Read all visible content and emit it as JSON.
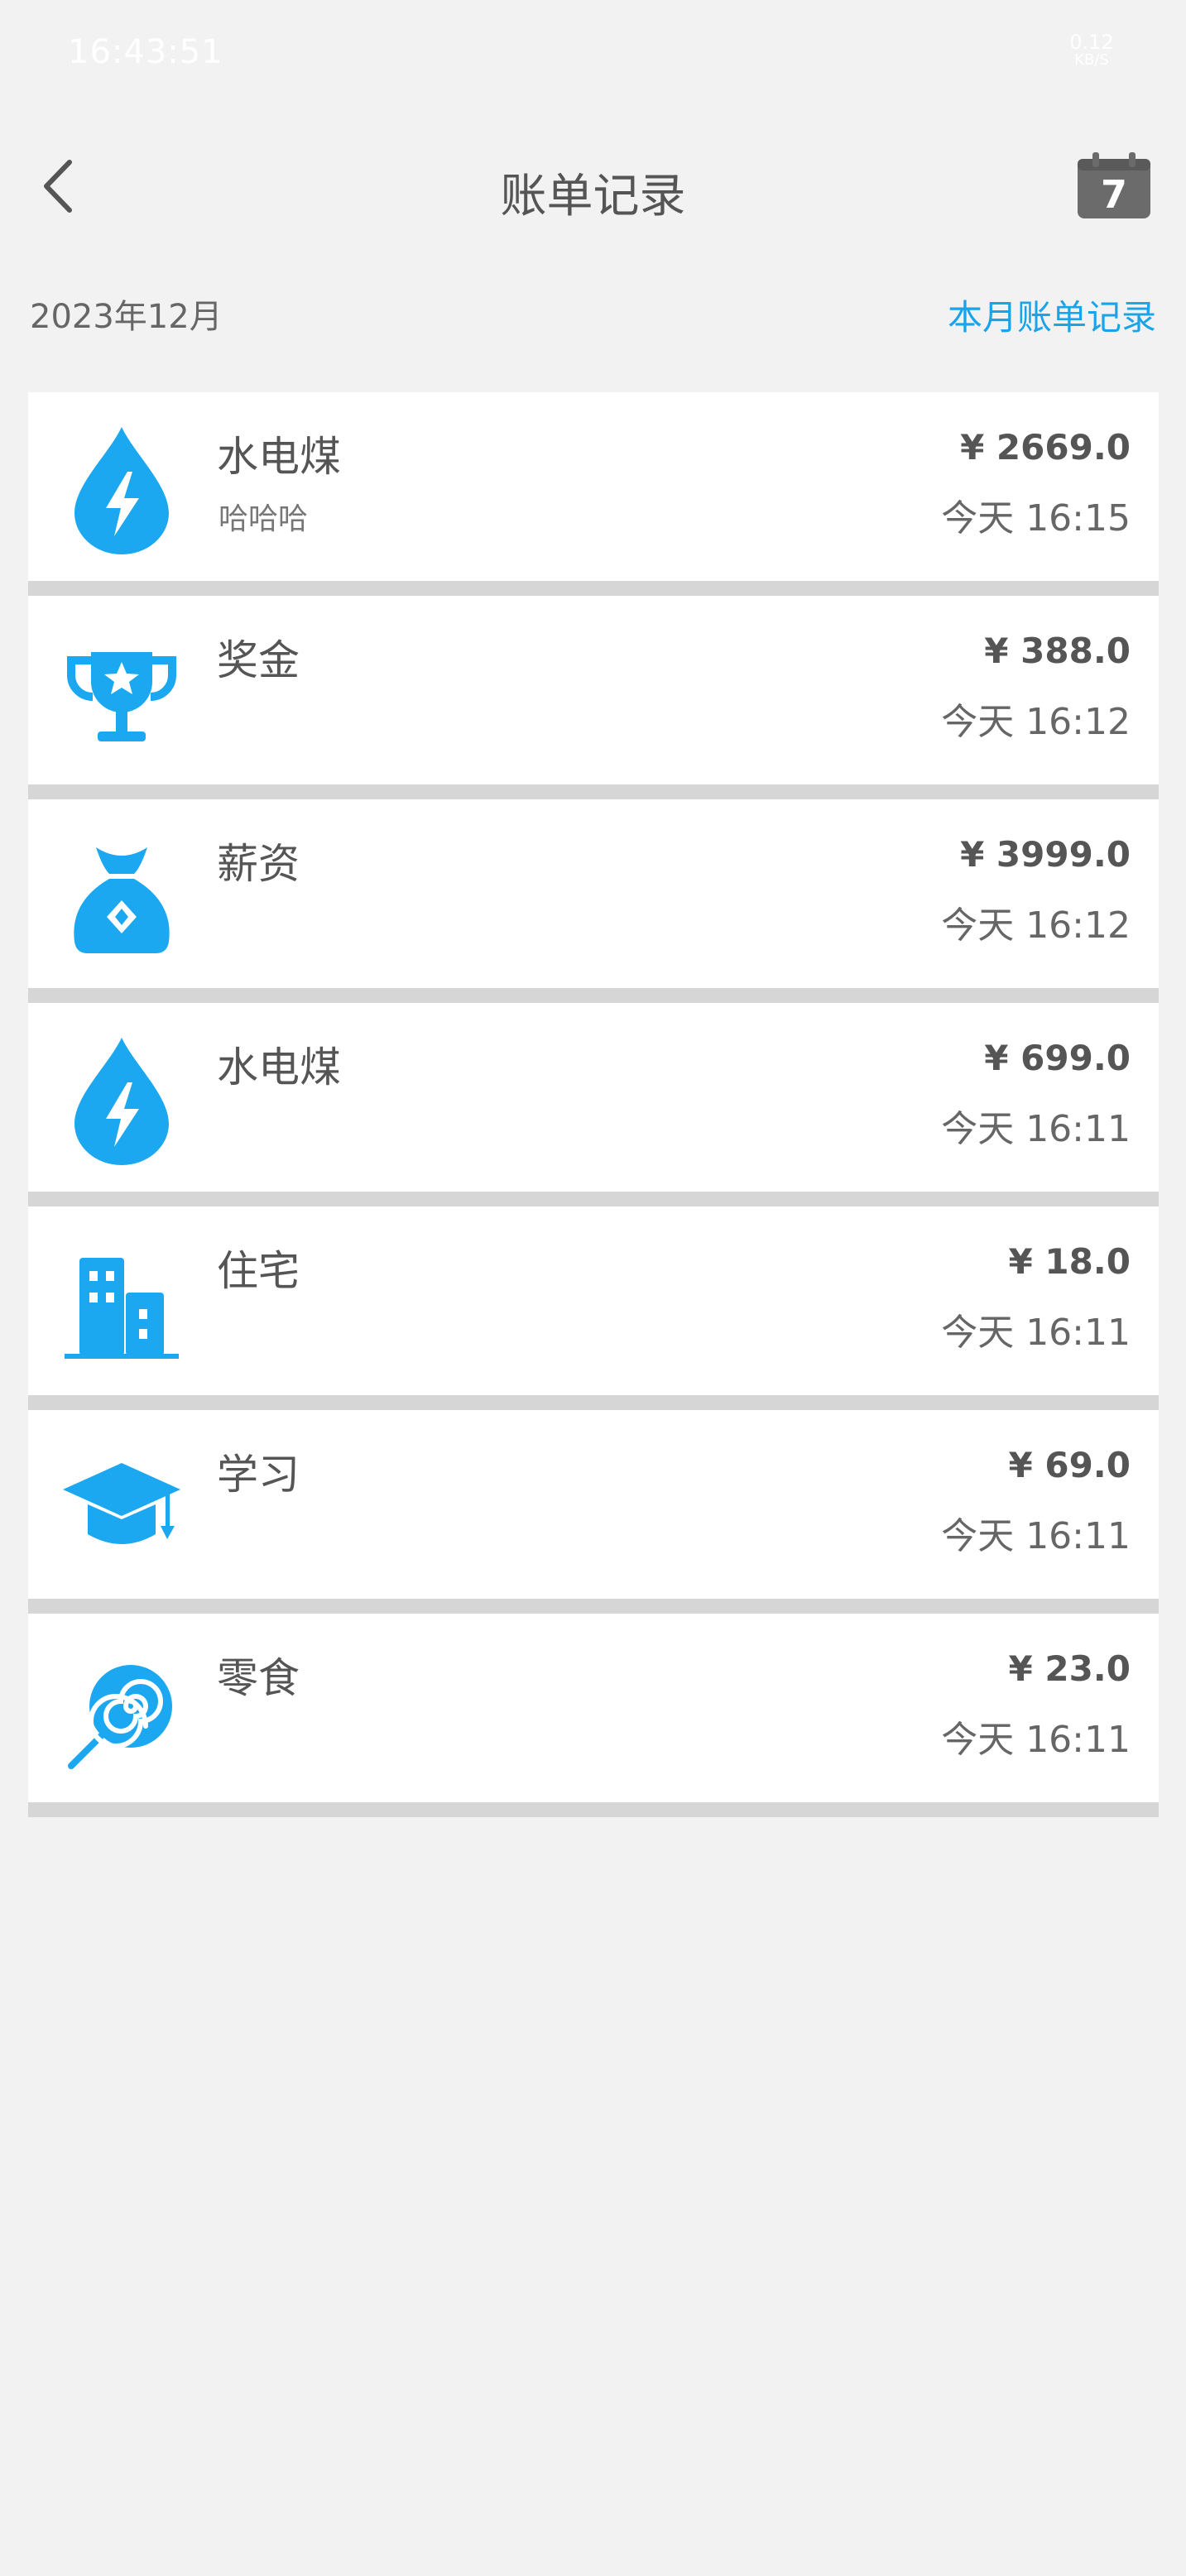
{
  "status_bar": {
    "time": "16:43:51",
    "net_speed_value": "0.12",
    "net_speed_unit": "KB/S"
  },
  "header": {
    "title": "账单记录",
    "calendar_day": "7"
  },
  "month": {
    "label": "2023年12月",
    "link": "本月账单记录"
  },
  "records": [
    {
      "icon": "utilities-icon",
      "category": "水电煤",
      "note": "哈哈哈",
      "amount": "¥ 2669.0",
      "time": "今天 16:15"
    },
    {
      "icon": "trophy-icon",
      "category": "奖金",
      "note": "",
      "amount": "¥ 388.0",
      "time": "今天 16:12"
    },
    {
      "icon": "money-bag-icon",
      "category": "薪资",
      "note": "",
      "amount": "¥ 3999.0",
      "time": "今天 16:12"
    },
    {
      "icon": "utilities-icon",
      "category": "水电煤",
      "note": "",
      "amount": "¥ 699.0",
      "time": "今天 16:11"
    },
    {
      "icon": "building-icon",
      "category": "住宅",
      "note": "",
      "amount": "¥ 18.0",
      "time": "今天 16:11"
    },
    {
      "icon": "graduation-cap-icon",
      "category": "学习",
      "note": "",
      "amount": "¥ 69.0",
      "time": "今天 16:11"
    },
    {
      "icon": "lollipop-icon",
      "category": "零食",
      "note": "",
      "amount": "¥ 23.0",
      "time": "今天 16:11"
    }
  ],
  "colors": {
    "accent": "#1aa3e8",
    "icon_blue": "#1ba8f0",
    "background": "#f2f2f2",
    "separator": "#d6d6d6"
  }
}
